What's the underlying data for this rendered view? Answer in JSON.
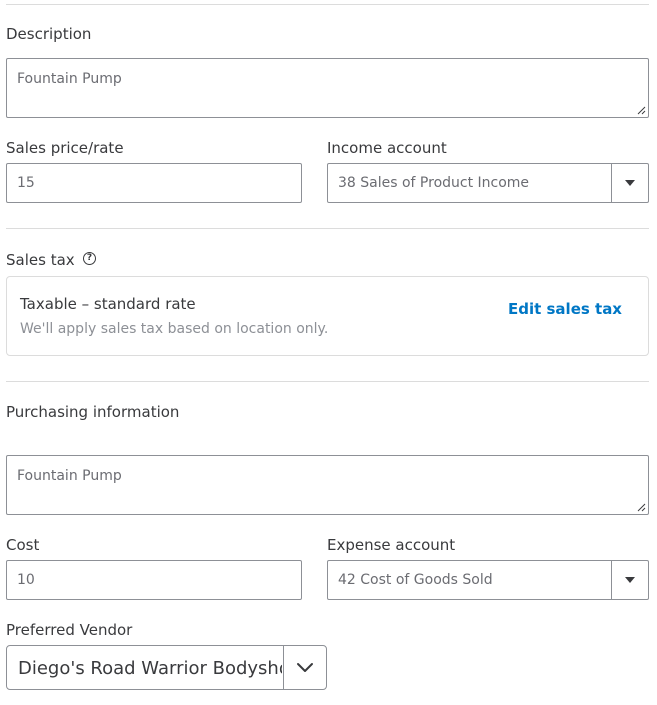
{
  "description": {
    "label": "Description",
    "value": "Fountain Pump"
  },
  "sales": {
    "price_label": "Sales price/rate",
    "price_value": "15",
    "income_account_label": "Income account",
    "income_account_value": "38 Sales of Product Income"
  },
  "sales_tax": {
    "label": "Sales tax",
    "help_icon": "help-circle-icon",
    "title": "Taxable – standard rate",
    "subtitle": "We'll apply sales tax based on location only.",
    "edit_link": "Edit sales tax"
  },
  "purchasing": {
    "heading": "Purchasing information",
    "description_value": "Fountain Pump",
    "cost_label": "Cost",
    "cost_value": "10",
    "expense_account_label": "Expense account",
    "expense_account_value": "42 Cost of Goods Sold",
    "vendor_label": "Preferred Vendor",
    "vendor_value": "Diego's Road Warrior Bodyshop"
  },
  "colors": {
    "link": "#0077c5",
    "text": "#393a3d",
    "muted": "#8d9096",
    "border": "#8d9096",
    "divider": "#dcdcdc"
  }
}
